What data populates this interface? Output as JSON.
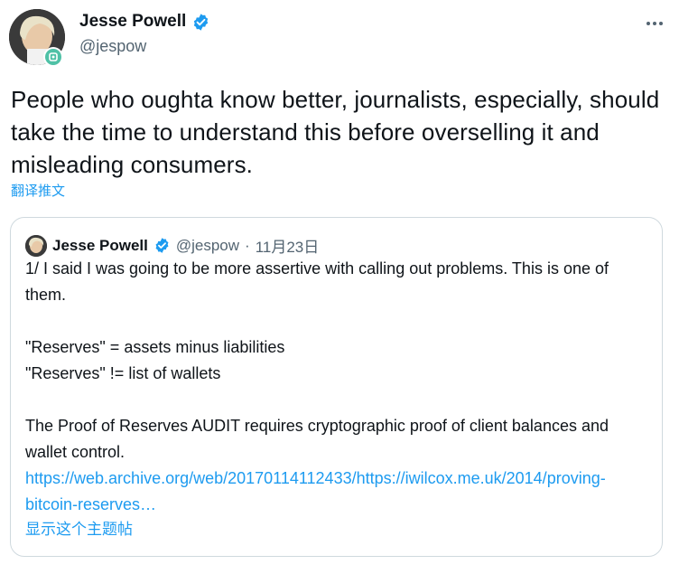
{
  "author": {
    "display_name": "Jesse Powell",
    "handle": "@jespow",
    "verified_icon": "verified-badge-icon",
    "avatar_badge_icon": "avatar-badge-icon"
  },
  "header": {
    "more_icon": "more-horizontal-icon"
  },
  "tweet": {
    "text": "People who oughta know better, journalists, especially, should take the time to understand this before overselling it and misleading consumers.",
    "translate_label": "翻译推文"
  },
  "quote": {
    "display_name": "Jesse Powell",
    "handle": "@jespow",
    "separator": "·",
    "date": "11月23日",
    "lines": [
      "1/ I said I was going to be more assertive with calling out problems. This is one of them.",
      "\"Reserves\" = assets minus liabilities",
      "\"Reserves\" != list of wallets",
      "The Proof of Reserves AUDIT requires cryptographic proof of client balances and wallet control."
    ],
    "link_text": "https://web.archive.org/web/20170114112433/https://iwilcox.me.uk/2014/proving-bitcoin-reserves…",
    "show_thread_label": "显示这个主题帖"
  },
  "colors": {
    "text": "#0f1419",
    "secondary": "#536471",
    "accent": "#1d9bf0",
    "border": "#cfd9de",
    "verified": "#1d9bf0"
  }
}
